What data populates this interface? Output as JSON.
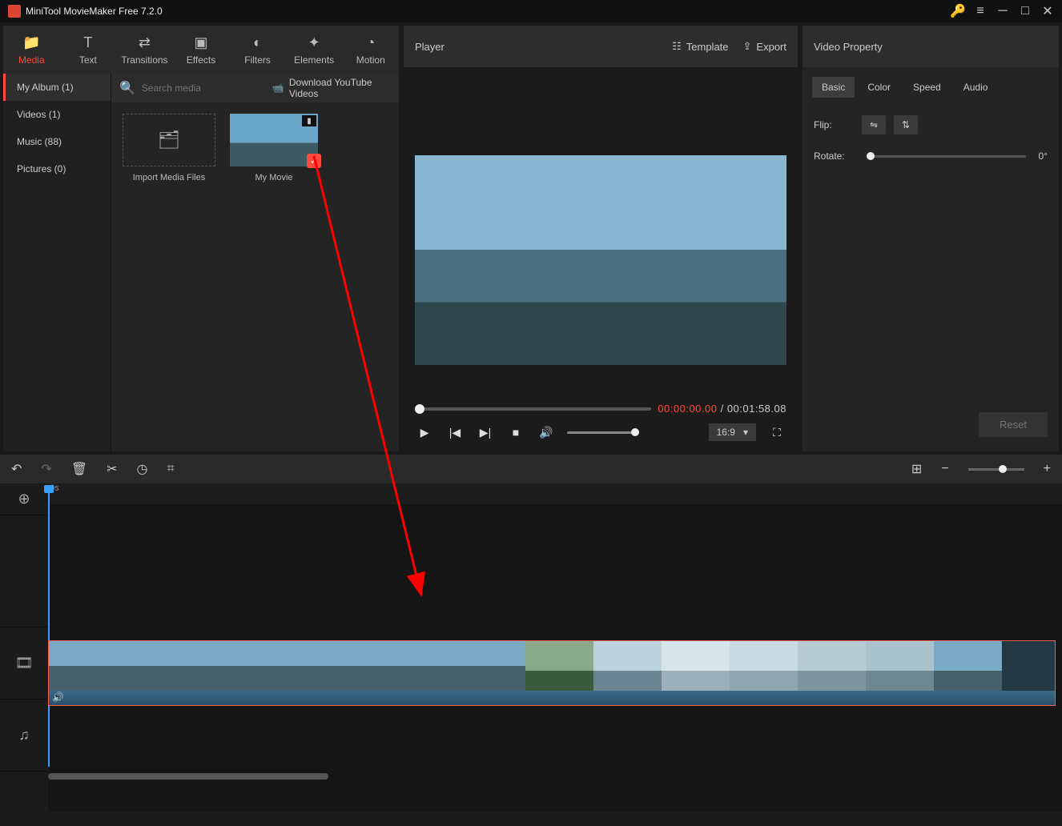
{
  "app": {
    "title": "MiniTool MovieMaker Free 7.2.0"
  },
  "tabs": [
    {
      "label": "Media",
      "active": true
    },
    {
      "label": "Text"
    },
    {
      "label": "Transitions"
    },
    {
      "label": "Effects"
    },
    {
      "label": "Filters"
    },
    {
      "label": "Elements"
    },
    {
      "label": "Motion"
    }
  ],
  "sidebar": [
    {
      "label": "My Album (1)",
      "active": true
    },
    {
      "label": "Videos (1)"
    },
    {
      "label": "Music (88)"
    },
    {
      "label": "Pictures (0)"
    }
  ],
  "search": {
    "placeholder": "Search media"
  },
  "download_label": "Download YouTube Videos",
  "import_label": "Import Media Files",
  "thumb_label": "My Movie",
  "player": {
    "title": "Player",
    "template": "Template",
    "export": "Export",
    "current": "00:00:00.00",
    "total": "00:01:58.08",
    "aspect": "16:9"
  },
  "prop": {
    "title": "Video Property",
    "tabs": [
      "Basic",
      "Color",
      "Speed",
      "Audio"
    ],
    "flip_label": "Flip:",
    "rotate_label": "Rotate:",
    "rotate_value": "0°",
    "reset": "Reset"
  },
  "ruler_start": "0s"
}
